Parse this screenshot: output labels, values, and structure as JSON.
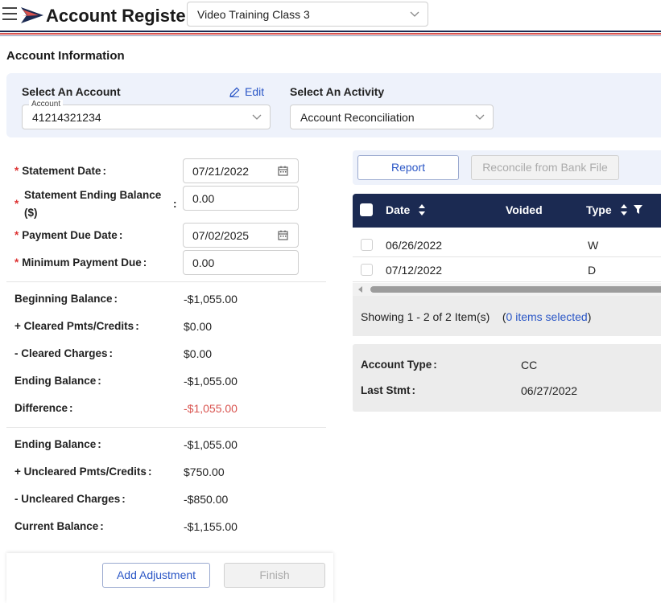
{
  "header": {
    "title": "Account Register",
    "class_selector": "Video Training Class 3"
  },
  "section_title": "Account Information",
  "selectors": {
    "account_label": "Select An Account",
    "edit_label": "Edit",
    "account_float_label": "Account",
    "account_value": "41214321234",
    "activity_label": "Select An Activity",
    "activity_value": "Account Reconciliation"
  },
  "form": {
    "statement_date_label": "Statement Date",
    "statement_date": "07/21/2022",
    "ending_balance_label_1": "Statement Ending Balance",
    "ending_balance_label_2": "($)",
    "ending_balance": "0.00",
    "payment_due_label": "Payment Due Date",
    "payment_due": "07/02/2025",
    "min_payment_label": "Minimum Payment Due",
    "min_payment": "0.00"
  },
  "summary1": {
    "beginning_balance_label": "Beginning Balance",
    "beginning_balance": "-$1,055.00",
    "cleared_credits_label": "+ Cleared Pmts/Credits",
    "cleared_credits": "$0.00",
    "cleared_charges_label": "- Cleared Charges",
    "cleared_charges": "$0.00",
    "ending_balance_label": "Ending Balance",
    "ending_balance": "-$1,055.00",
    "difference_label": "Difference",
    "difference": "-$1,055.00"
  },
  "summary2": {
    "ending_balance_label": "Ending Balance",
    "ending_balance": "-$1,055.00",
    "uncleared_credits_label": "+ Uncleared Pmts/Credits",
    "uncleared_credits": "$750.00",
    "uncleared_charges_label": "- Uncleared Charges",
    "uncleared_charges": "-$850.00",
    "current_balance_label": "Current Balance",
    "current_balance": "-$1,155.00"
  },
  "buttons": {
    "add_adjustment": "Add Adjustment",
    "finish": "Finish",
    "report": "Report",
    "reconcile": "Reconcile from Bank File"
  },
  "grid": {
    "columns": {
      "date": "Date",
      "voided": "Voided",
      "type": "Type"
    },
    "rows": [
      {
        "date": "06/26/2022",
        "voided": "",
        "type": "W"
      },
      {
        "date": "07/12/2022",
        "voided": "",
        "type": "D"
      }
    ],
    "pager_text": "Showing 1 - 2 of 2 Item(s)",
    "selected_open": "(",
    "selected_text": "0 items selected",
    "selected_close": ")"
  },
  "account_info": {
    "type_label": "Account Type",
    "type_value": "CC",
    "last_stmt_label": "Last Stmt",
    "last_stmt_value": "06/27/2022"
  },
  "colors": {
    "navy": "#1b2a52",
    "red_stripe": "#d9534f",
    "link_blue": "#2a56c6"
  }
}
